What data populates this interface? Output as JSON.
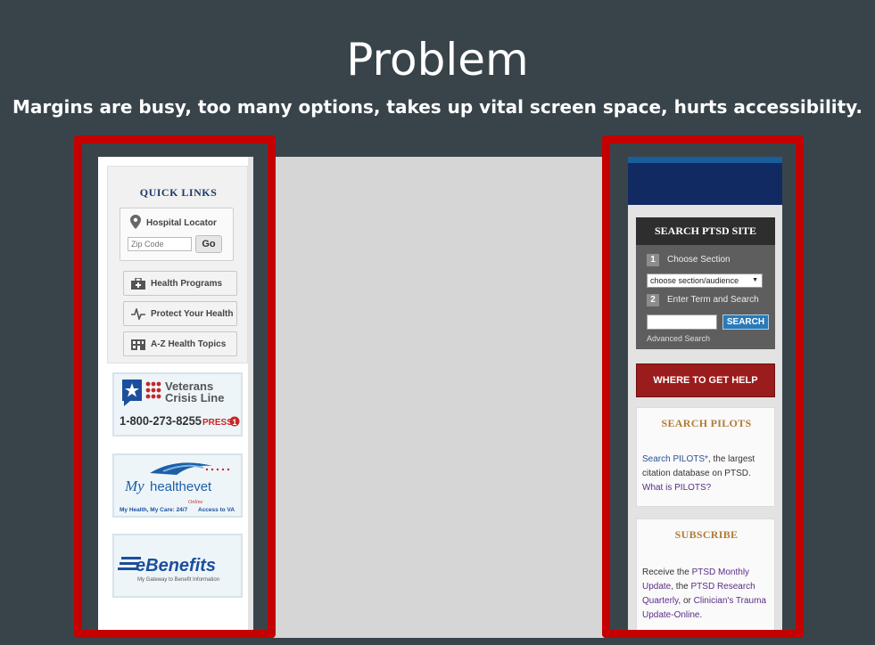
{
  "slide": {
    "title": "Problem",
    "subtitle": "Margins are busy, too many options, takes up vital screen space, hurts accessibility."
  },
  "left": {
    "quick_links_title": "QUICK LINKS",
    "locator_label": "Hospital Locator",
    "zip_placeholder": "Zip Code",
    "go_label": "Go",
    "buttons": [
      {
        "label": "Health Programs",
        "icon": "medical-kit-icon"
      },
      {
        "label": "Protect Your Health",
        "icon": "pulse-icon"
      },
      {
        "label": "A-Z Health Topics",
        "icon": "building-icon"
      }
    ],
    "vcl": {
      "line1": "Veterans",
      "line2": "Crisis Line",
      "phone": "1-800-273-8255",
      "press": "PRESS",
      "press_num": "1"
    },
    "mhv": {
      "my": "My",
      "brand": "healthevet",
      "tagline": "My Health, My Care: 24/7",
      "online": "Online",
      "tagline2": "Access to VA"
    },
    "ebenefits": {
      "brand": "eBenefits",
      "tagline": "My Gateway to Benefit Information"
    }
  },
  "right": {
    "search_title": "SEARCH PTSD SITE",
    "step1_num": "1",
    "step1_label": "Choose Section",
    "select_value": "choose section/audience",
    "step2_num": "2",
    "step2_label": "Enter Term and Search",
    "search_button": "SEARCH",
    "advanced_link": "Advanced Search",
    "help_button": "WHERE TO GET HELP",
    "pilots_title": "SEARCH PILOTS",
    "pilots_link": "Search PILOTS*",
    "pilots_text": ", the largest citation database on PTSD.",
    "pilots_what": "What is PILOTS?",
    "subscribe_title": "SUBSCRIBE",
    "sub_receive": "Receive the ",
    "sub_link1": "PTSD Monthly Update",
    "sub_mid": ", the ",
    "sub_link2": "PTSD Research Quarterly",
    "sub_or": ", or ",
    "sub_link3": "Clinician's Trauma Update-Online",
    "sub_end": "."
  },
  "colors": {
    "highlight": "#c40000",
    "background": "#39444a",
    "navy": "#122a62",
    "help_red": "#9b1c1c"
  }
}
